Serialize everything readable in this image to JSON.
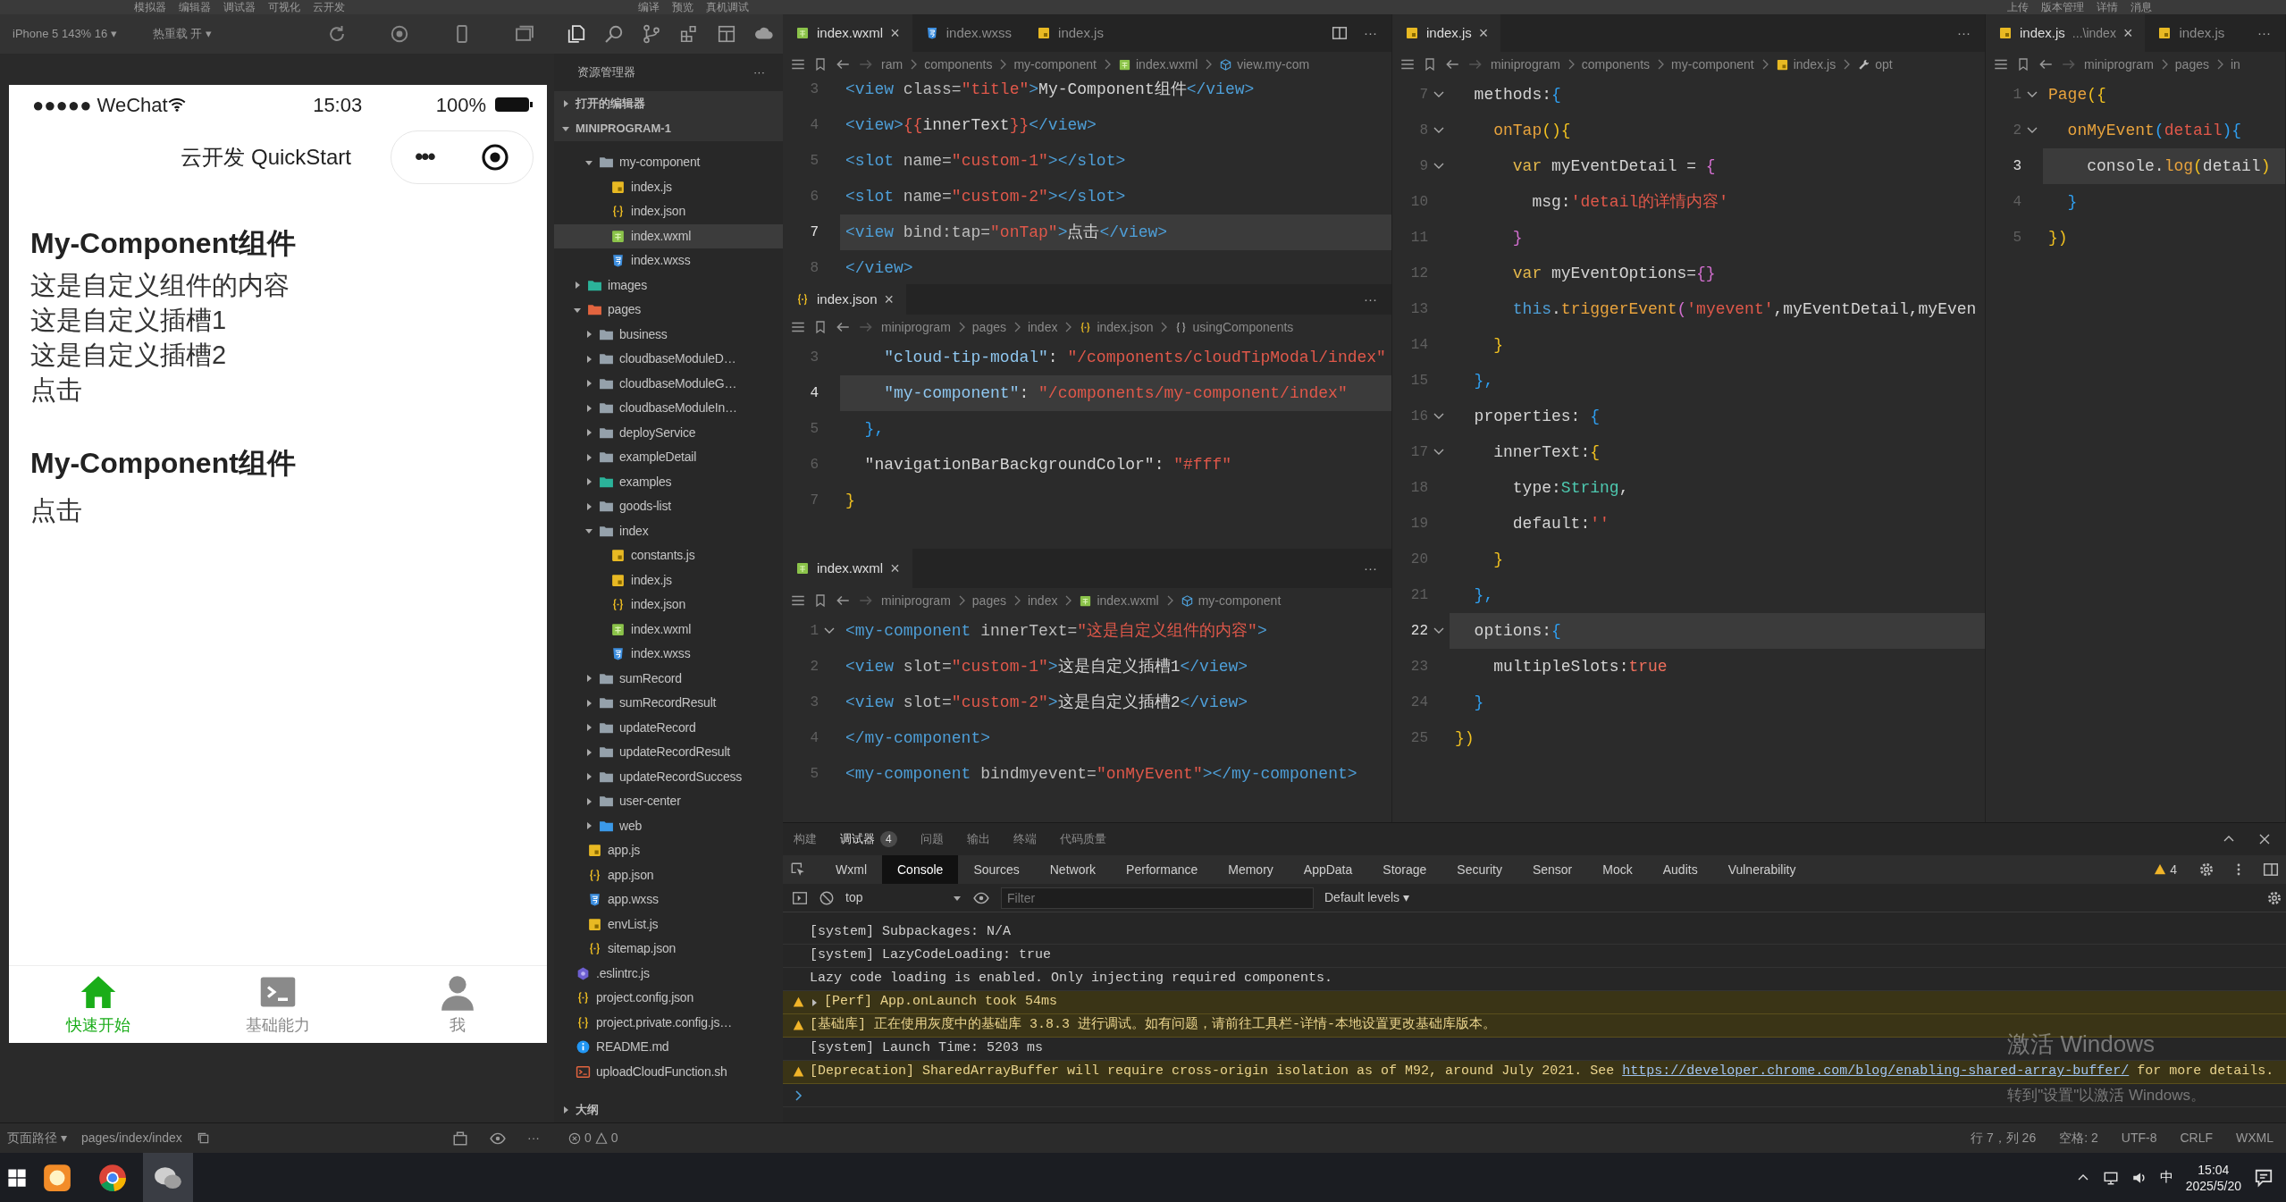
{
  "menu": {
    "left": [
      "模拟器",
      "编辑器",
      "调试器",
      "可视化",
      "云开发"
    ],
    "middle": [
      "编译",
      "预览",
      "真机调试"
    ],
    "right": [
      "上传",
      "版本管理",
      "详情",
      "消息"
    ]
  },
  "simulator": {
    "device": "iPhone 5 143% 16 ▾",
    "hot_reload": "热重载 开 ▾",
    "phone": {
      "carrier": "●●●●● WeChat",
      "time": "15:03",
      "battery": "100%",
      "nav_title": "云开发 QuickStart",
      "capsule_more": "•••",
      "blocks": [
        {
          "title": "My-Component组件",
          "lines": [
            "这是自定义组件的内容",
            "这是自定义插槽1",
            "这是自定义插槽2",
            "点击"
          ]
        },
        {
          "title": "My-Component组件",
          "lines": [
            "点击"
          ]
        }
      ],
      "tabbar": [
        {
          "label": "快速开始",
          "kind": "home",
          "selected": true
        },
        {
          "label": "基础能力",
          "kind": "terminal",
          "selected": false
        },
        {
          "label": "我",
          "kind": "person",
          "selected": false
        }
      ]
    }
  },
  "explorer": {
    "title": "资源管理器",
    "more": "···",
    "sections": [
      {
        "label": "打开的编辑器",
        "expanded": false
      },
      {
        "label": "MINIPROGRAM-1",
        "expanded": true
      }
    ],
    "tree": [
      {
        "children": [
          {
            "children": [
              {
                "label": "my-component",
                "kind": "folder",
                "expanded": true,
                "selected": false,
                "children": [
                  {
                    "label": "index.js",
                    "kind": "js",
                    "selected": false
                  },
                  {
                    "label": "index.json",
                    "kind": "json",
                    "selected": false
                  },
                  {
                    "label": "index.wxml",
                    "kind": "wxml",
                    "selected": true
                  },
                  {
                    "label": "index.wxss",
                    "kind": "wxss",
                    "selected": false
                  }
                ]
              }
            ]
          },
          {
            "label": "images",
            "kind": "folder-images",
            "expanded": false,
            "selected": false
          },
          {
            "label": "pages",
            "kind": "folder-pages",
            "expanded": true,
            "selected": false,
            "children": [
              {
                "label": "business",
                "kind": "folder",
                "expanded": false,
                "selected": false
              },
              {
                "label": "cloudbaseModuleD…",
                "kind": "folder",
                "expanded": false,
                "selected": false
              },
              {
                "label": "cloudbaseModuleG…",
                "kind": "folder",
                "expanded": false,
                "selected": false
              },
              {
                "label": "cloudbaseModuleIn…",
                "kind": "folder",
                "expanded": false,
                "selected": false
              },
              {
                "label": "deployService",
                "kind": "folder",
                "expanded": false,
                "selected": false
              },
              {
                "label": "exampleDetail",
                "kind": "folder",
                "expanded": false,
                "selected": false
              },
              {
                "label": "examples",
                "kind": "folder-examples",
                "expanded": false,
                "selected": false
              },
              {
                "label": "goods-list",
                "kind": "folder",
                "expanded": false,
                "selected": false
              },
              {
                "label": "index",
                "kind": "folder",
                "expanded": true,
                "selected": false,
                "children": [
                  {
                    "label": "constants.js",
                    "kind": "js",
                    "selected": false
                  },
                  {
                    "label": "index.js",
                    "kind": "js",
                    "selected": false
                  },
                  {
                    "label": "index.json",
                    "kind": "json",
                    "selected": false
                  },
                  {
                    "label": "index.wxml",
                    "kind": "wxml",
                    "selected": false
                  },
                  {
                    "label": "index.wxss",
                    "kind": "wxss",
                    "selected": false
                  }
                ]
              },
              {
                "label": "sumRecord",
                "kind": "folder",
                "expanded": false,
                "selected": false
              },
              {
                "label": "sumRecordResult",
                "kind": "folder",
                "expanded": false,
                "selected": false
              },
              {
                "label": "updateRecord",
                "kind": "folder",
                "expanded": false,
                "selected": false
              },
              {
                "label": "updateRecordResult",
                "kind": "folder",
                "expanded": false,
                "selected": false
              },
              {
                "label": "updateRecordSuccess",
                "kind": "folder",
                "expanded": false,
                "selected": false
              },
              {
                "label": "user-center",
                "kind": "folder",
                "expanded": false,
                "selected": false
              },
              {
                "label": "web",
                "kind": "folder-web",
                "expanded": false,
                "selected": false
              }
            ]
          },
          {
            "label": "app.js",
            "kind": "js",
            "selected": false
          },
          {
            "label": "app.json",
            "kind": "json",
            "selected": false
          },
          {
            "label": "app.wxss",
            "kind": "wxss",
            "selected": false
          },
          {
            "label": "envList.js",
            "kind": "js",
            "selected": false
          },
          {
            "label": "sitemap.json",
            "kind": "json",
            "selected": false
          }
        ]
      },
      {
        "label": ".eslintrc.js",
        "kind": "eslint",
        "selected": false
      },
      {
        "label": "project.config.json",
        "kind": "json",
        "selected": false
      },
      {
        "label": "project.private.config.js…",
        "kind": "json",
        "selected": false
      },
      {
        "label": "README.md",
        "kind": "info",
        "selected": false
      },
      {
        "label": "uploadCloudFunction.sh",
        "kind": "sh",
        "selected": false
      }
    ],
    "outline": {
      "label": "大纲",
      "expanded": false
    }
  },
  "editor_groups": [
    {
      "panes": [
        {
          "split_button": true,
          "more": "···",
          "tabs": [
            {
              "label": "index.wxml",
              "kind": "wxml",
              "close": "×",
              "selected": true
            },
            {
              "label": "index.wxss",
              "kind": "wxss",
              "selected": false
            },
            {
              "label": "index.js",
              "kind": "js",
              "selected": false
            }
          ],
          "breadcrumb": [
            {
              "label": "ram",
              "kind": "path"
            },
            {
              "label": "components",
              "kind": "path"
            },
            {
              "label": "my-component",
              "kind": "path"
            },
            {
              "label": "index.wxml",
              "kind": "wxml"
            },
            {
              "label": "view.my-com",
              "kind": "symbol"
            }
          ],
          "lines": [
            {
              "number": "3",
              "fold": false,
              "current": false,
              "tokens": [
                {
                  "kind": "tag",
                  "text": "<view"
                },
                {
                  "kind": "attr",
                  "text": " class="
                },
                {
                  "kind": "str",
                  "text": "\"title\""
                },
                {
                  "kind": "tag",
                  "text": ">"
                },
                {
                  "kind": "plain",
                  "text": "My-Component组件"
                },
                {
                  "kind": "tag",
                  "text": "</view>"
                }
              ]
            },
            {
              "number": "4",
              "fold": false,
              "current": false,
              "tokens": [
                {
                  "kind": "tag",
                  "text": "<view>"
                },
                {
                  "kind": "str",
                  "text": "{{"
                },
                {
                  "kind": "plain",
                  "text": "innerText"
                },
                {
                  "kind": "str",
                  "text": "}}"
                },
                {
                  "kind": "tag",
                  "text": "</view>"
                }
              ]
            },
            {
              "number": "5",
              "fold": false,
              "current": false,
              "tokens": [
                {
                  "kind": "tag",
                  "text": "<slot"
                },
                {
                  "kind": "attr",
                  "text": " name="
                },
                {
                  "kind": "str",
                  "text": "\"custom-1\""
                },
                {
                  "kind": "tag",
                  "text": "></slot>"
                }
              ]
            },
            {
              "number": "6",
              "fold": false,
              "current": false,
              "tokens": [
                {
                  "kind": "tag",
                  "text": "<slot"
                },
                {
                  "kind": "attr",
                  "text": " name="
                },
                {
                  "kind": "str",
                  "text": "\"custom-2\""
                },
                {
                  "kind": "tag",
                  "text": "></slot>"
                }
              ]
            },
            {
              "number": "7",
              "fold": false,
              "current": true,
              "tokens": [
                {
                  "kind": "tag",
                  "text": "<view"
                },
                {
                  "kind": "attr",
                  "text": " bind:tap="
                },
                {
                  "kind": "str",
                  "text": "\"onTap\""
                },
                {
                  "kind": "tag",
                  "text": ">"
                },
                {
                  "kind": "plain",
                  "text": "点击"
                },
                {
                  "kind": "tag",
                  "text": "</view>"
                }
              ]
            },
            {
              "number": "8",
              "fold": false,
              "current": false,
              "tokens": [
                {
                  "kind": "tag",
                  "text": "</view>"
                }
              ]
            }
          ]
        },
        {
          "more": "···",
          "tabs": [
            {
              "label": "index.json",
              "kind": "json",
              "close": "×",
              "selected": true
            }
          ],
          "breadcrumb": [
            {
              "label": "miniprogram",
              "kind": "path"
            },
            {
              "label": "pages",
              "kind": "path"
            },
            {
              "label": "index",
              "kind": "path"
            },
            {
              "label": "index.json",
              "kind": "json"
            },
            {
              "label": "usingComponents",
              "kind": "braces"
            }
          ],
          "lines": [
            {
              "number": "3",
              "fold": false,
              "current": false,
              "tokens": [
                {
                  "kind": "key",
                  "text": "    \"cloud-tip-modal\""
                },
                {
                  "kind": "plain",
                  "text": ": "
                },
                {
                  "kind": "str",
                  "text": "\"/components/cloudTipModal/index\""
                }
              ]
            },
            {
              "number": "4",
              "fold": false,
              "current": true,
              "tokens": [
                {
                  "kind": "key",
                  "text": "    \"my-component\""
                },
                {
                  "kind": "plain",
                  "text": ": "
                },
                {
                  "kind": "str",
                  "text": "\"/components/my-component/index\""
                }
              ]
            },
            {
              "number": "5",
              "fold": false,
              "current": false,
              "tokens": [
                {
                  "kind": "b3",
                  "text": "  },"
                }
              ]
            },
            {
              "number": "6",
              "fold": false,
              "current": false,
              "tokens": [
                {
                  "kind": "plain",
                  "text": "  \"navigationBarBackgroundColor\": "
                },
                {
                  "kind": "str",
                  "text": "\"#fff\""
                }
              ]
            },
            {
              "number": "7",
              "fold": false,
              "current": false,
              "tokens": [
                {
                  "kind": "b1",
                  "text": "}"
                }
              ]
            }
          ]
        },
        {
          "more": "···",
          "tabs": [
            {
              "label": "index.wxml",
              "kind": "wxml",
              "close": "×",
              "selected": true
            }
          ],
          "breadcrumb": [
            {
              "label": "miniprogram",
              "kind": "path"
            },
            {
              "label": "pages",
              "kind": "path"
            },
            {
              "label": "index",
              "kind": "path"
            },
            {
              "label": "index.wxml",
              "kind": "wxml"
            },
            {
              "label": "my-component",
              "kind": "symbol"
            }
          ],
          "lines": [
            {
              "number": "1",
              "fold": true,
              "current": false,
              "tokens": [
                {
                  "kind": "tag",
                  "text": "<my-component"
                },
                {
                  "kind": "attr",
                  "text": " innerText="
                },
                {
                  "kind": "str",
                  "text": "\"这是自定义组件的内容\""
                },
                {
                  "kind": "tag",
                  "text": ">"
                }
              ]
            },
            {
              "number": "2",
              "fold": false,
              "current": false,
              "tokens": [
                {
                  "kind": "tag",
                  "text": "<view"
                },
                {
                  "kind": "attr",
                  "text": " slot="
                },
                {
                  "kind": "str",
                  "text": "\"custom-1\""
                },
                {
                  "kind": "tag",
                  "text": ">"
                },
                {
                  "kind": "plain",
                  "text": "这是自定义插槽1"
                },
                {
                  "kind": "tag",
                  "text": "</view>"
                }
              ]
            },
            {
              "number": "3",
              "fold": false,
              "current": false,
              "tokens": [
                {
                  "kind": "tag",
                  "text": "<view"
                },
                {
                  "kind": "attr",
                  "text": " slot="
                },
                {
                  "kind": "str",
                  "text": "\"custom-2\""
                },
                {
                  "kind": "tag",
                  "text": ">"
                },
                {
                  "kind": "plain",
                  "text": "这是自定义插槽2"
                },
                {
                  "kind": "tag",
                  "text": "</view>"
                }
              ]
            },
            {
              "number": "4",
              "fold": false,
              "current": false,
              "tokens": [
                {
                  "kind": "tag",
                  "text": "</my-component>"
                }
              ]
            },
            {
              "number": "5",
              "fold": false,
              "current": false,
              "tokens": [
                {
                  "kind": "tag",
                  "text": "<my-component"
                },
                {
                  "kind": "attr",
                  "text": " bindmyevent="
                },
                {
                  "kind": "str",
                  "text": "\"onMyEvent\""
                },
                {
                  "kind": "tag",
                  "text": "></my-component>"
                }
              ]
            }
          ]
        }
      ]
    },
    {
      "panes": [
        {
          "more": "···",
          "tabs": [
            {
              "label": "index.js",
              "kind": "js",
              "close": "×",
              "selected": true
            }
          ],
          "breadcrumb": [
            {
              "label": "miniprogram",
              "kind": "path"
            },
            {
              "label": "components",
              "kind": "path"
            },
            {
              "label": "my-component",
              "kind": "path"
            },
            {
              "label": "index.js",
              "kind": "js"
            },
            {
              "label": "opt",
              "kind": "wrench"
            }
          ],
          "lines": [
            {
              "number": "7",
              "fold": true,
              "current": false,
              "tokens": [
                {
                  "kind": "plain",
                  "text": "  methods:"
                },
                {
                  "kind": "b3",
                  "text": "{"
                }
              ]
            },
            {
              "number": "8",
              "fold": true,
              "current": false,
              "tokens": [
                {
                  "kind": "fn",
                  "text": "    onTap"
                },
                {
                  "kind": "b1",
                  "text": "(){"
                }
              ]
            },
            {
              "number": "9",
              "fold": true,
              "current": false,
              "tokens": [
                {
                  "kind": "kw",
                  "text": "      var"
                },
                {
                  "kind": "plain",
                  "text": " myEventDetail = "
                },
                {
                  "kind": "b2",
                  "text": "{"
                }
              ]
            },
            {
              "number": "10",
              "fold": false,
              "current": false,
              "tokens": [
                {
                  "kind": "plain",
                  "text": "        msg:"
                },
                {
                  "kind": "str",
                  "text": "'detail的详情内容'"
                }
              ]
            },
            {
              "number": "11",
              "fold": false,
              "current": false,
              "tokens": [
                {
                  "kind": "b2",
                  "text": "      }"
                }
              ]
            },
            {
              "number": "12",
              "fold": false,
              "current": false,
              "tokens": [
                {
                  "kind": "kw",
                  "text": "      var"
                },
                {
                  "kind": "plain",
                  "text": " myEventOptions="
                },
                {
                  "kind": "b2",
                  "text": "{}"
                }
              ]
            },
            {
              "number": "13",
              "fold": false,
              "current": false,
              "tokens": [
                {
                  "kind": "this",
                  "text": "      this"
                },
                {
                  "kind": "plain",
                  "text": "."
                },
                {
                  "kind": "fn",
                  "text": "triggerEvent"
                },
                {
                  "kind": "b2",
                  "text": "("
                },
                {
                  "kind": "str",
                  "text": "'myevent'"
                },
                {
                  "kind": "plain",
                  "text": ",myEventDetail,myEven"
                }
              ]
            },
            {
              "number": "14",
              "fold": false,
              "current": false,
              "tokens": [
                {
                  "kind": "b1",
                  "text": "    }"
                }
              ]
            },
            {
              "number": "15",
              "fold": false,
              "current": false,
              "tokens": [
                {
                  "kind": "b3",
                  "text": "  },"
                }
              ]
            },
            {
              "number": "16",
              "fold": true,
              "current": false,
              "tokens": [
                {
                  "kind": "plain",
                  "text": "  properties: "
                },
                {
                  "kind": "b3",
                  "text": "{"
                }
              ]
            },
            {
              "number": "17",
              "fold": true,
              "current": false,
              "tokens": [
                {
                  "kind": "plain",
                  "text": "    innerText:"
                },
                {
                  "kind": "b1",
                  "text": "{"
                }
              ]
            },
            {
              "number": "18",
              "fold": false,
              "current": false,
              "tokens": [
                {
                  "kind": "plain",
                  "text": "      type:"
                },
                {
                  "kind": "type",
                  "text": "String"
                },
                {
                  "kind": "plain",
                  "text": ","
                }
              ]
            },
            {
              "number": "19",
              "fold": false,
              "current": false,
              "tokens": [
                {
                  "kind": "plain",
                  "text": "      default:"
                },
                {
                  "kind": "str",
                  "text": "''"
                }
              ]
            },
            {
              "number": "20",
              "fold": false,
              "current": false,
              "tokens": [
                {
                  "kind": "b1",
                  "text": "    }"
                }
              ]
            },
            {
              "number": "21",
              "fold": false,
              "current": false,
              "tokens": [
                {
                  "kind": "b3",
                  "text": "  },"
                }
              ]
            },
            {
              "number": "22",
              "fold": true,
              "current": true,
              "tokens": [
                {
                  "kind": "plain",
                  "text": "  options:"
                },
                {
                  "kind": "b3",
                  "text": "{"
                }
              ]
            },
            {
              "number": "23",
              "fold": false,
              "current": false,
              "tokens": [
                {
                  "kind": "plain",
                  "text": "    multipleSlots:"
                },
                {
                  "kind": "bool",
                  "text": "true"
                }
              ]
            },
            {
              "number": "24",
              "fold": false,
              "current": false,
              "tokens": [
                {
                  "kind": "b3",
                  "text": "  }"
                }
              ]
            },
            {
              "number": "25",
              "fold": false,
              "current": false,
              "tokens": [
                {
                  "kind": "b1",
                  "text": "})"
                }
              ]
            }
          ]
        }
      ]
    },
    {
      "panes": [
        {
          "more": "···",
          "tabs": [
            {
              "label": "index.js",
              "kind": "js",
              "desc": "...\\index",
              "close": "×",
              "selected": true
            },
            {
              "label": "index.js",
              "kind": "js",
              "selected": false
            }
          ],
          "breadcrumb": [
            {
              "label": "miniprogram",
              "kind": "path"
            },
            {
              "label": "pages",
              "kind": "path"
            },
            {
              "label": "in",
              "kind": "path"
            }
          ],
          "lines": [
            {
              "number": "1",
              "fold": true,
              "current": false,
              "tokens": [
                {
                  "kind": "fn",
                  "text": "Page"
                },
                {
                  "kind": "b1",
                  "text": "({"
                }
              ]
            },
            {
              "number": "2",
              "fold": true,
              "current": false,
              "tokens": [
                {
                  "kind": "fn",
                  "text": "  onMyEvent"
                },
                {
                  "kind": "b3",
                  "text": "("
                },
                {
                  "kind": "str",
                  "text": "detail"
                },
                {
                  "kind": "b3",
                  "text": "){"
                }
              ]
            },
            {
              "number": "3",
              "fold": false,
              "current": true,
              "tokens": [
                {
                  "kind": "plain",
                  "text": "    console."
                },
                {
                  "kind": "fn",
                  "text": "log"
                },
                {
                  "kind": "b1",
                  "text": "("
                },
                {
                  "kind": "plain",
                  "text": "detail"
                },
                {
                  "kind": "b1",
                  "text": ")"
                }
              ]
            },
            {
              "number": "4",
              "fold": false,
              "current": false,
              "tokens": [
                {
                  "kind": "b3",
                  "text": "  }"
                }
              ]
            },
            {
              "number": "5",
              "fold": false,
              "current": false,
              "tokens": [
                {
                  "kind": "b1",
                  "text": "})"
                }
              ]
            }
          ]
        }
      ]
    }
  ],
  "panel": {
    "tabs": [
      {
        "label": "构建",
        "selected": false
      },
      {
        "label": "调试器",
        "badge": "4",
        "selected": true
      },
      {
        "label": "问题",
        "selected": false
      },
      {
        "label": "输出",
        "selected": false
      },
      {
        "label": "终端",
        "selected": false
      },
      {
        "label": "代码质量",
        "selected": false
      }
    ],
    "devtools_tabs": [
      {
        "label": "Wxml",
        "selected": false
      },
      {
        "label": "Console",
        "selected": true
      },
      {
        "label": "Sources",
        "selected": false
      },
      {
        "label": "Network",
        "selected": false
      },
      {
        "label": "Performance",
        "selected": false
      },
      {
        "label": "Memory",
        "selected": false
      },
      {
        "label": "AppData",
        "selected": false
      },
      {
        "label": "Storage",
        "selected": false
      },
      {
        "label": "Security",
        "selected": false
      },
      {
        "label": "Sensor",
        "selected": false
      },
      {
        "label": "Mock",
        "selected": false
      },
      {
        "label": "Audits",
        "selected": false
      },
      {
        "label": "Vulnerability",
        "selected": false
      }
    ],
    "warning_count": "4",
    "filter": {
      "context": "top",
      "placeholder": "Filter",
      "levels": "Default levels ▾"
    },
    "console": [
      {
        "kind": "info",
        "text": "[system] Subpackages: N/A"
      },
      {
        "kind": "info",
        "text": "[system] LazyCodeLoading: true"
      },
      {
        "kind": "info",
        "text": "Lazy code loading is enabled. Only injecting required components."
      },
      {
        "kind": "warn",
        "expanded": false,
        "text": "[Perf] App.onLaunch took 54ms"
      },
      {
        "kind": "warn",
        "text": "[基础库] 正在使用灰度中的基础库 3.8.3 进行调试。如有问题，请前往工具栏-详情-本地设置更改基础库版本。"
      },
      {
        "kind": "info",
        "text": "[system] Launch Time: 5203 ms"
      },
      {
        "kind": "warn",
        "text": "[Deprecation] SharedArrayBuffer will require cross-origin isolation as of M92, around July 2021. See ",
        "link": "https://developer.chrome.com/blog/enabling-shared-array-buffer/",
        "after": " for more details."
      },
      {
        "kind": "prompt"
      }
    ],
    "windows_notice": [
      "激活 Windows",
      "转到\"设置\"以激活 Windows。"
    ]
  },
  "status_bar": {
    "page_path": "页面路径 ▾",
    "path": "pages/index/index",
    "more": "···",
    "errors": "0",
    "warnings": "0",
    "right": [
      "行 7，列 26",
      "空格: 2",
      "UTF-8",
      "CRLF",
      "WXML"
    ]
  },
  "taskbar": {
    "apps": [
      {
        "kind": "orange"
      },
      {
        "kind": "browser"
      },
      {
        "kind": "chat"
      }
    ],
    "ime": "中",
    "time": "15:04",
    "date": "2025/5/20"
  }
}
